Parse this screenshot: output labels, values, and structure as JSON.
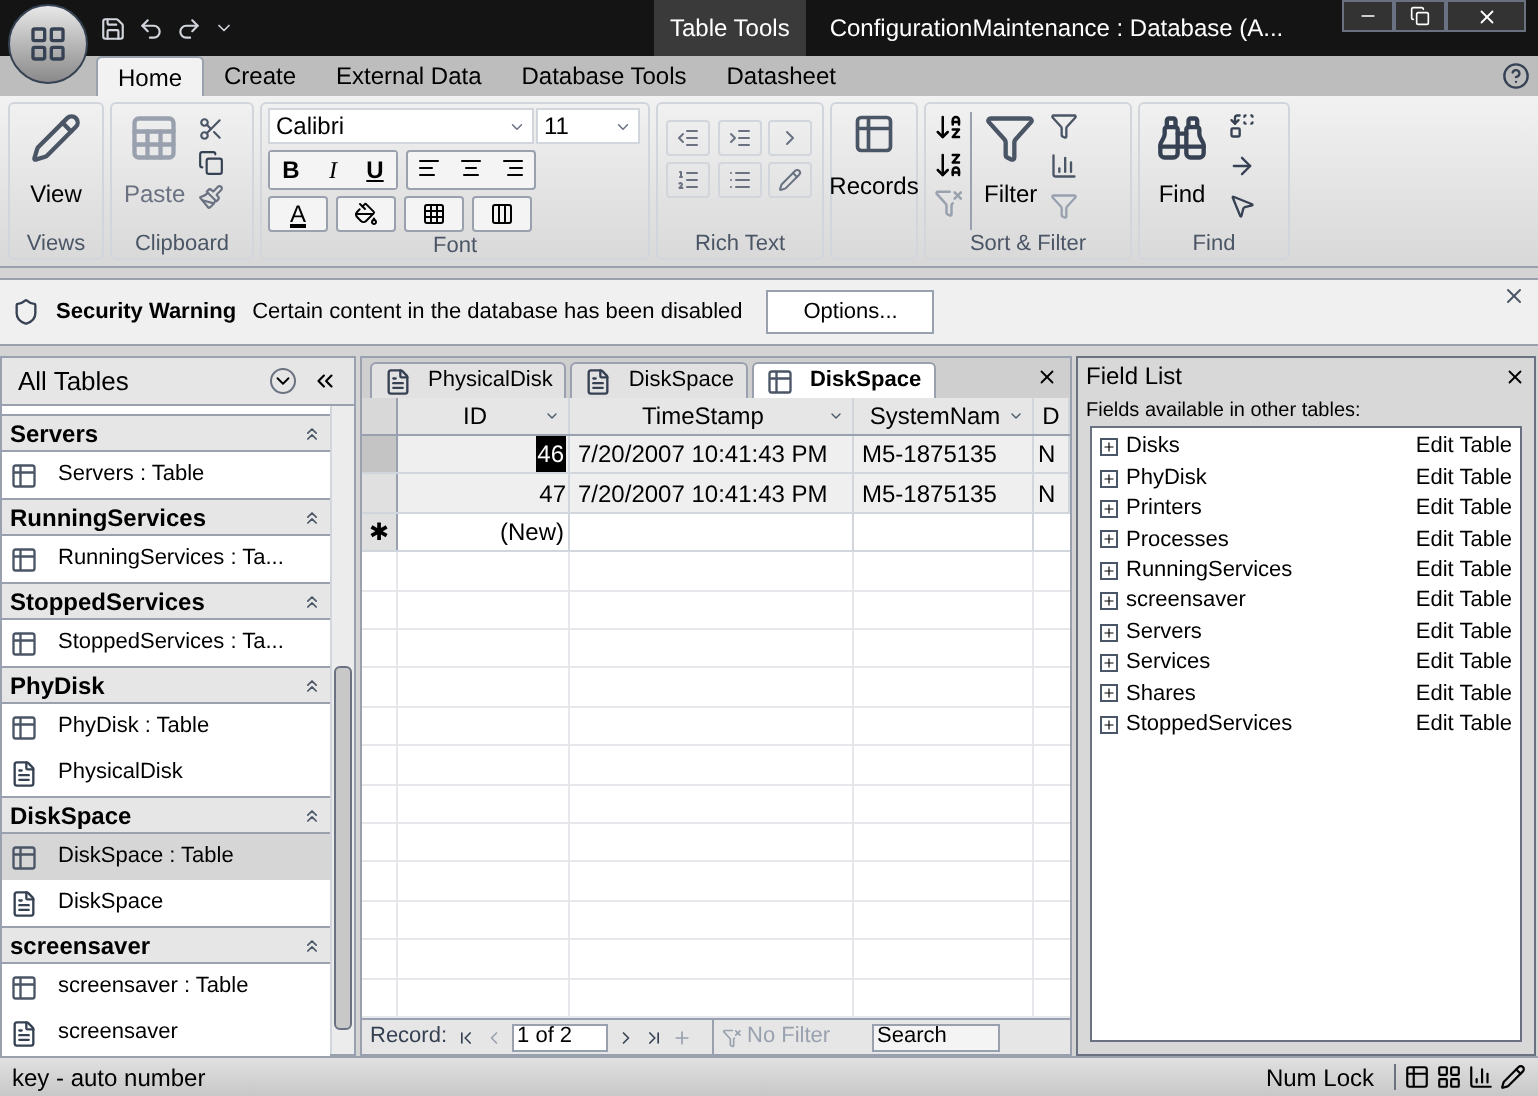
{
  "title_bar": {
    "context_tab": "Table Tools",
    "title": "ConfigurationMaintenance : Database (A..."
  },
  "ribbon_tabs": [
    {
      "label": "Home",
      "selected": true
    },
    {
      "label": "Create",
      "selected": false
    },
    {
      "label": "External Data",
      "selected": false
    },
    {
      "label": "Database Tools",
      "selected": false
    },
    {
      "label": "Datasheet",
      "selected": false
    }
  ],
  "ribbon": {
    "views": {
      "button": "View",
      "group": "Views"
    },
    "clipboard": {
      "button": "Paste",
      "group": "Clipboard"
    },
    "font": {
      "family": "Calibri",
      "size": "11",
      "styles": [
        "B",
        "I",
        "U"
      ],
      "color_letter": "A",
      "group": "Font"
    },
    "rich_text": {
      "group": "Rich Text"
    },
    "records": {
      "button": "Records"
    },
    "sort_filter": {
      "button": "Filter",
      "group": "Sort & Filter"
    },
    "find": {
      "button": "Find",
      "group": "Find"
    }
  },
  "security_bar": {
    "label": "Security Warning",
    "message": "Certain content in the database has been disabled",
    "button": "Options..."
  },
  "nav_pane": {
    "title": "All Tables",
    "groups": [
      {
        "name": "Servers",
        "items": [
          {
            "kind": "table",
            "label": "Servers : Table",
            "selected": false
          }
        ]
      },
      {
        "name": "RunningServices",
        "items": [
          {
            "kind": "table",
            "label": "RunningServices : Ta...",
            "selected": false
          }
        ]
      },
      {
        "name": "StoppedServices",
        "items": [
          {
            "kind": "table",
            "label": "StoppedServices : Ta...",
            "selected": false
          }
        ]
      },
      {
        "name": "PhyDisk",
        "items": [
          {
            "kind": "table",
            "label": "PhyDisk : Table",
            "selected": false
          },
          {
            "kind": "report",
            "label": "PhysicalDisk",
            "selected": false
          }
        ]
      },
      {
        "name": "DiskSpace",
        "items": [
          {
            "kind": "table",
            "label": "DiskSpace : Table",
            "selected": true
          },
          {
            "kind": "report",
            "label": "DiskSpace",
            "selected": false
          }
        ]
      },
      {
        "name": "screensaver",
        "items": [
          {
            "kind": "table",
            "label": "screensaver : Table",
            "selected": false
          },
          {
            "kind": "report",
            "label": "screensaver",
            "selected": false
          }
        ]
      }
    ]
  },
  "doc_tabs": [
    {
      "kind": "report",
      "label": "PhysicalDisk",
      "selected": false
    },
    {
      "kind": "report",
      "label": "DiskSpace",
      "selected": false
    },
    {
      "kind": "table",
      "label": "DiskSpace",
      "selected": true
    }
  ],
  "datasheet": {
    "columns": [
      "ID",
      "TimeStamp",
      "SystemNam",
      "D"
    ],
    "rows": [
      {
        "cells": [
          "46",
          "7/20/2007 10:41:43 PM",
          "M5-1875135",
          "N"
        ],
        "selected": true
      },
      {
        "cells": [
          "47",
          "7/20/2007 10:41:43 PM",
          "M5-1875135",
          "N"
        ],
        "selected": false
      }
    ],
    "new_row": {
      "marker": "✱",
      "label": "(New)"
    }
  },
  "record_nav": {
    "label": "Record:",
    "position": "1 of 2",
    "filter": "No Filter",
    "search_placeholder": "Search"
  },
  "field_list": {
    "title": "Field List",
    "caption": "Fields available in other tables:",
    "tables": [
      {
        "name": "Disks",
        "action": "Edit Table"
      },
      {
        "name": "PhyDisk",
        "action": "Edit Table"
      },
      {
        "name": "Printers",
        "action": "Edit Table"
      },
      {
        "name": "Processes",
        "action": "Edit Table"
      },
      {
        "name": "RunningServices",
        "action": "Edit Table"
      },
      {
        "name": "screensaver",
        "action": "Edit Table"
      },
      {
        "name": "Servers",
        "action": "Edit Table"
      },
      {
        "name": "Services",
        "action": "Edit Table"
      },
      {
        "name": "Shares",
        "action": "Edit Table"
      },
      {
        "name": "StoppedServices",
        "action": "Edit Table"
      }
    ]
  },
  "status_bar": {
    "message": "key - auto number",
    "indicator": "Num Lock"
  }
}
